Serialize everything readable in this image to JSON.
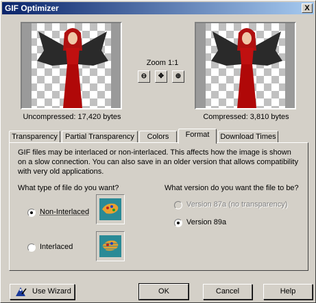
{
  "window": {
    "title": "GIF Optimizer",
    "close": "X"
  },
  "preview": {
    "zoom_label": "Zoom 1:1",
    "uncompressed": "Uncompressed:  17,420 bytes",
    "compressed": "Compressed: 3,810 bytes",
    "zoom_buttons": {
      "zoom_out": "⊖",
      "pan": "✥",
      "zoom_in": "⊕"
    }
  },
  "tabs": [
    "Transparency",
    "Partial Transparency",
    "Colors",
    "Format",
    "Download Times"
  ],
  "active_tab": "Format",
  "format": {
    "description": "GIF files may be interlaced or non-interlaced. This affects how the image is shown on a slow connection. You can also save in an older version that allows compatibility with very old applications.",
    "type_question": "What type of file do you want?",
    "version_question": "What version do you want the file to be?",
    "type_options": [
      {
        "label": "Non-Interlaced",
        "checked": true
      },
      {
        "label": "Interlaced",
        "checked": false
      }
    ],
    "version_options": [
      {
        "label": "Version 87a (no transparency)",
        "checked": false,
        "disabled": true
      },
      {
        "label": "Version 89a",
        "checked": true,
        "disabled": false
      }
    ]
  },
  "buttons": {
    "use_wizard": "Use Wizard",
    "ok": "OK",
    "cancel": "Cancel",
    "help": "Help"
  },
  "colors": {
    "titlebar_start": "#0a246a",
    "face": "#d4d0c8",
    "thumb_bg": "#2a8a96"
  }
}
